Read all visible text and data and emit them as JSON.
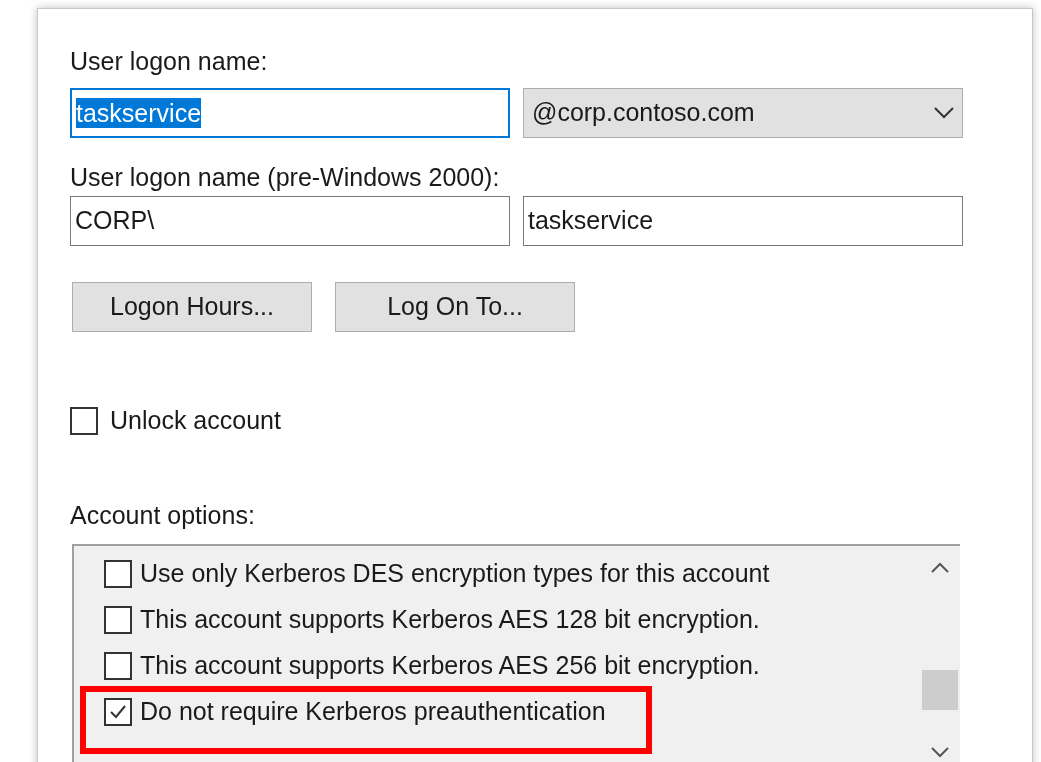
{
  "logon_name": {
    "label": "User logon name:",
    "value": "taskservice",
    "selected_text": true,
    "domain": "@corp.contoso.com"
  },
  "pre_windows_2000": {
    "label": "User logon name (pre-Windows 2000):",
    "domain": "CORP\\",
    "value": "taskservice"
  },
  "buttons": [
    "Logon Hours...",
    "Log On To..."
  ],
  "unlock_account": {
    "label": "Unlock account",
    "checked": false
  },
  "account_options": {
    "label": "Account options:",
    "options": [
      {
        "label": "Use only Kerberos DES encryption types for this account",
        "checked": false,
        "highlighted": false
      },
      {
        "label": "This account supports Kerberos AES 128 bit encryption.",
        "checked": false,
        "highlighted": false
      },
      {
        "label": "This account supports Kerberos AES 256 bit encryption.",
        "checked": false,
        "highlighted": false
      },
      {
        "label": "Do not require Kerberos preauthentication",
        "checked": true,
        "highlighted": true
      }
    ]
  }
}
